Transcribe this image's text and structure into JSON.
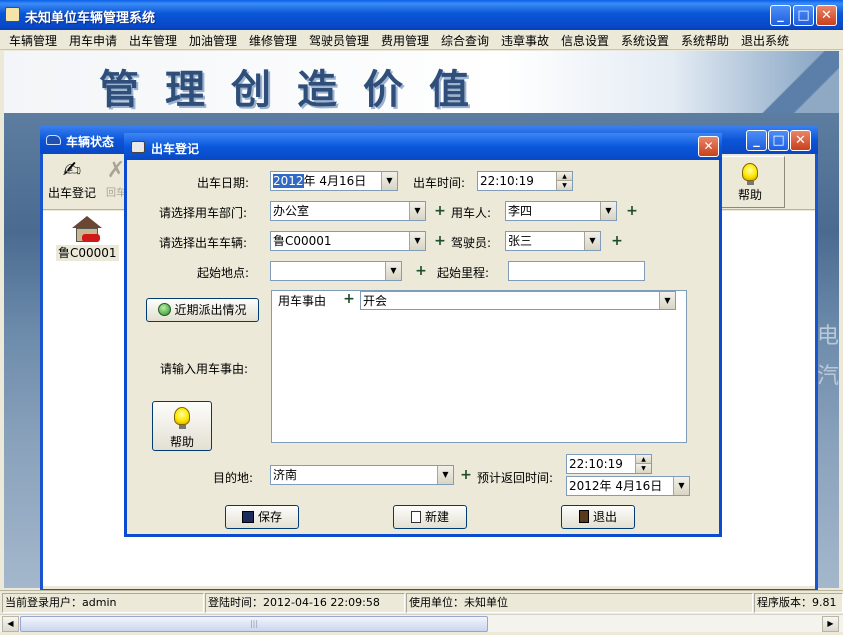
{
  "window": {
    "title": "未知单位车辆管理系统",
    "minimize": "_",
    "maximize": "□",
    "close": "✕"
  },
  "menu": [
    "车辆管理",
    "用车申请",
    "出车管理",
    "加油管理",
    "维修管理",
    "驾驶员管理",
    "费用管理",
    "综合查询",
    "违章事故",
    "信息设置",
    "系统设置",
    "系统帮助",
    "退出系统"
  ],
  "banner": {
    "slogan": "管理创造价值",
    "ghost_a": "电",
    "ghost_b": "汽"
  },
  "child_window": {
    "title": "车辆状态",
    "toolbar": {
      "dispatch_label": "出车登记",
      "return_label": "回车",
      "help_label": "帮助"
    },
    "vehicle": "鲁C00001"
  },
  "dialog": {
    "title": "出车登记",
    "labels": {
      "date": "出车日期:",
      "time": "出车时间:",
      "department": "请选择用车部门:",
      "user": "用车人:",
      "vehicle": "请选择出车车辆:",
      "driver": "驾驶员:",
      "start_place": "起始地点:",
      "start_mileage": "起始里程:",
      "reason_header": "用车事由",
      "reason_prompt": "请输入用车事由:",
      "destination": "目的地:",
      "return_time": "预计返回时间:"
    },
    "values": {
      "date_year": "2012",
      "date_rest": "年  4月16日",
      "time": "22:10:19",
      "department": "办公室",
      "user": "李四",
      "vehicle": "鲁C00001",
      "driver": "张三",
      "start_place": "",
      "start_mileage": "",
      "reason": "开会",
      "destination": "济南",
      "return_time": "22:10:19",
      "return_date": "2012年  4月16日"
    },
    "buttons": {
      "recent": "近期派出情况",
      "help": "帮助",
      "save": "保存",
      "new": "新建",
      "exit": "退出"
    }
  },
  "status": {
    "user": "当前登录用户：admin",
    "login_time": "登陆时间：2012-04-16 22:09:58",
    "unit": "使用单位：未知单位",
    "version": "程序版本：9.81"
  }
}
